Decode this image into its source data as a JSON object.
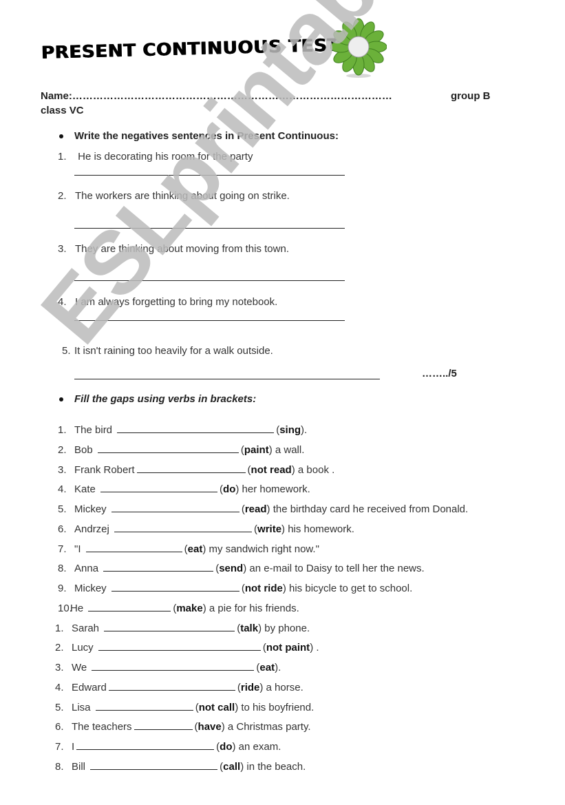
{
  "title": "PRESENT CONTINUOUS TEST 2",
  "logo_icon": "flower-icon",
  "header": {
    "name_label": "Name:…………………………………………………………………………………",
    "group": "group B",
    "class": "class VC"
  },
  "watermark": "ESLprintables.com",
  "section1": {
    "bullet_icon": "bullet-icon",
    "heading": "Write the negatives sentences in Present Continuous:",
    "items": [
      {
        "num": "1.",
        "text": " He is decorating his room for the party"
      },
      {
        "num": "2.",
        "text": "The workers are thinking about going on strike."
      },
      {
        "num": "3.",
        "text": "They are thinking about moving from this town."
      },
      {
        "num": "4.",
        "text": "I am always forgetting to bring my notebook."
      },
      {
        "num": "5.",
        "text": "It isn't raining too heavily for a walk outside."
      }
    ],
    "score": "……../5"
  },
  "section2": {
    "bullet_icon": "bullet-icon",
    "heading": "Fill the gaps using verbs in brackets:",
    "items": [
      {
        "num": "1.",
        "before": "The bird ",
        "verb": "sing",
        "after": "."
      },
      {
        "num": "2.",
        "before": "Bob ",
        "verb": "paint",
        "after": " a wall."
      },
      {
        "num": "3.",
        "before": "Frank Robert",
        "verb": "not read",
        "after": " a book ."
      },
      {
        "num": "4.",
        "before": "Kate ",
        "verb": "do",
        "after": " her homework."
      },
      {
        "num": "5.",
        "before": "Mickey ",
        "verb": "read",
        "after": " the birthday card he received from Donald."
      },
      {
        "num": "6.",
        "before": "Andrzej ",
        "verb": "write",
        "after": " his homework."
      },
      {
        "num": "7.",
        "before": "\"I ",
        "verb": "eat",
        "after": " my sandwich right now.\""
      },
      {
        "num": "8.",
        "before": "Anna ",
        "verb": "send",
        "after": " an e-mail to Daisy to tell her the news."
      },
      {
        "num": "9.",
        "before": "Mickey ",
        "verb": "not ride",
        "after": " his bicycle to get to school."
      },
      {
        "num": "10.",
        "before": "He ",
        "verb": "make",
        "after": " a pie for his friends."
      }
    ]
  },
  "section3": {
    "items": [
      {
        "num": "1.",
        "before": "Sarah ",
        "verb": "talk",
        "after": " by phone."
      },
      {
        "num": "2.",
        "before": "Lucy ",
        "verb": "not paint",
        "after": " ."
      },
      {
        "num": "3.",
        "before": "We ",
        "verb": "eat",
        "after": "."
      },
      {
        "num": "4.",
        "before": "Edward",
        "verb": "ride",
        "after": " a horse."
      },
      {
        "num": "5.",
        "before": "Lisa  ",
        "verb": "not call",
        "after": " to his boyfriend."
      },
      {
        "num": "6.",
        "before": "The teachers",
        "verb": "have",
        "after": " a Christmas party."
      },
      {
        "num": "7.",
        "before": "I",
        "verb": "do",
        "after": " an exam."
      },
      {
        "num": "8.",
        "before": "Bill ",
        "verb": "call",
        "after": " in the beach."
      }
    ]
  }
}
